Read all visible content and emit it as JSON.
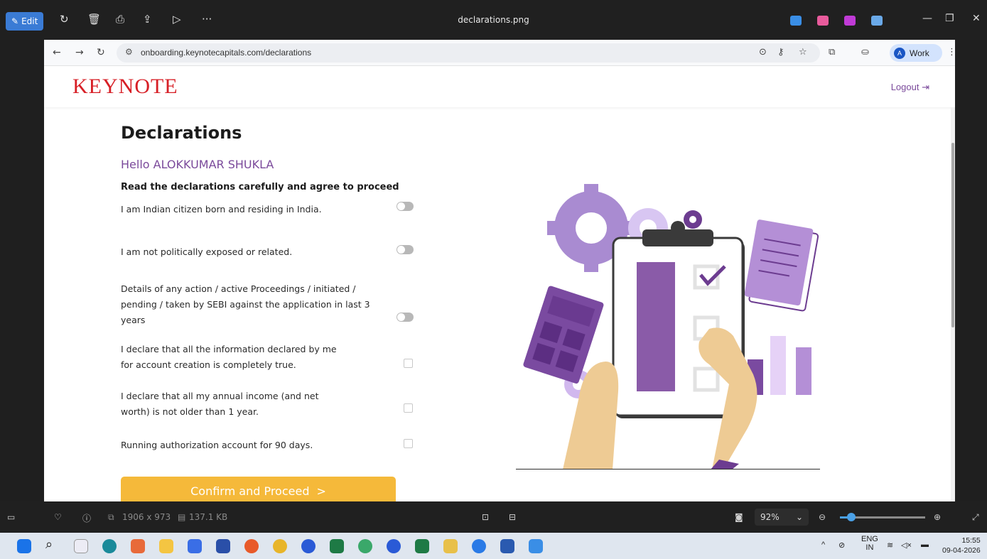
{
  "viewer": {
    "edit_label": "Edit",
    "file_title": "declarations.png",
    "more_label": "···",
    "image_dims": "1906 x 973",
    "file_size": "137.1 KB",
    "zoom_level": "92%",
    "zoom_fraction": 0.13
  },
  "browser": {
    "url": "onboarding.keynotecapitals.com/declarations",
    "profile_label": "Work",
    "profile_initial": "A"
  },
  "site": {
    "logo": "KEYNOTE",
    "logout": "Logout"
  },
  "form": {
    "title": "Declarations",
    "greeting": "Hello ALOKKUMAR SHUKLA",
    "instruction": "Read the declarations carefully and agree to proceed",
    "declarations": [
      {
        "text": "I am Indian citizen born and residing in India.",
        "control": "toggle",
        "checked": false
      },
      {
        "text": "I am not politically exposed or related.",
        "control": "toggle",
        "checked": false
      },
      {
        "text": "Details of any action / active Proceedings / initiated / pending / taken by SEBI against the application in last 3 years",
        "control": "toggle",
        "checked": false
      },
      {
        "text": "I declare that all the information declared by me for account creation is completely true.",
        "control": "checkbox",
        "checked": false
      },
      {
        "text": "I declare that all my annual income (and net worth) is not older than 1 year.",
        "control": "checkbox",
        "checked": false
      },
      {
        "text": "Running authorization account for 90 days.",
        "control": "checkbox",
        "checked": false
      }
    ],
    "submit_label": "Confirm and Proceed",
    "submit_icon": "chevron-right-icon",
    "accent": "#7b4a9b",
    "button_color": "#f5b93a"
  },
  "taskbar": {
    "lang_top": "ENG",
    "lang_bottom": "IN",
    "time": "15:55",
    "date": "09-04-2026"
  }
}
